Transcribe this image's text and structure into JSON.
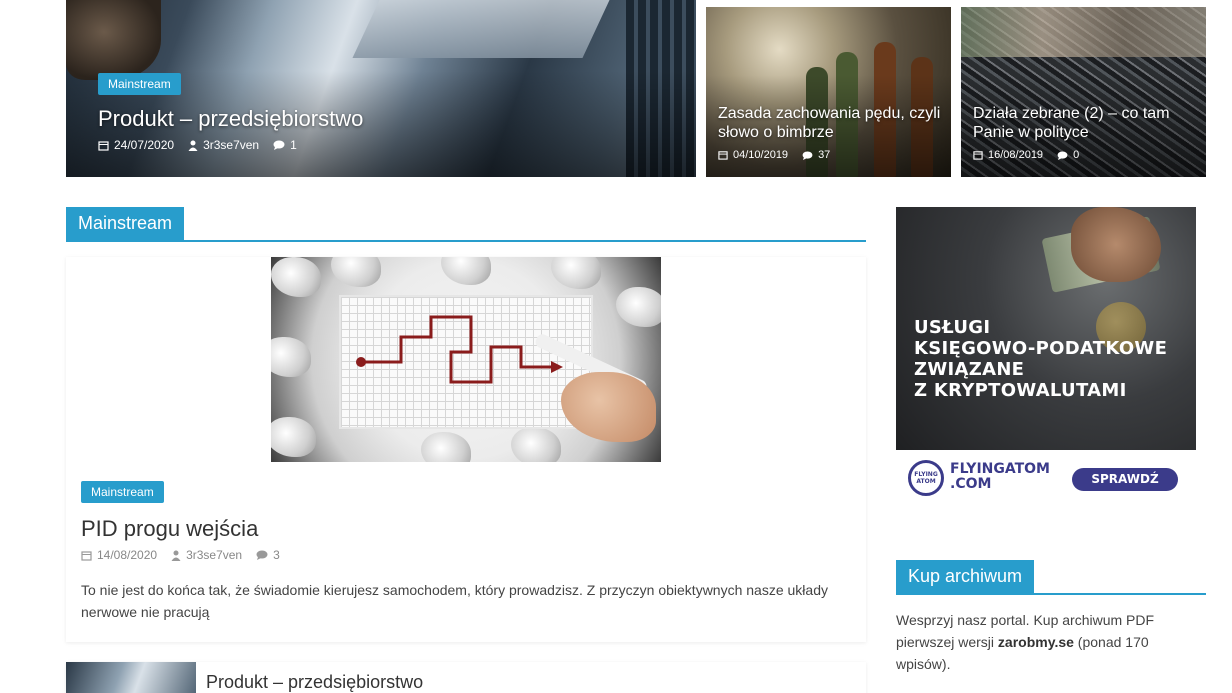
{
  "featured": {
    "big": {
      "category": "Mainstream",
      "title": "Produkt – przedsiębiorstwo",
      "date": "24/07/2020",
      "author": "3r3se7ven",
      "comments": "1"
    },
    "small": [
      {
        "title": "Zasada zachowania pędu, czyli słowo o bimbrze",
        "date": "04/10/2019",
        "comments": "37"
      },
      {
        "title": "Działa zebrane (2) – co tam Panie w polityce",
        "date": "16/08/2019",
        "comments": "0"
      }
    ]
  },
  "section": {
    "title": "Mainstream"
  },
  "post": {
    "category": "Mainstream",
    "title": "PID progu wejścia",
    "date": "14/08/2020",
    "author": "3r3se7ven",
    "comments": "3",
    "excerpt": "To nie jest do końca tak, że świadomie kierujesz samochodem, który prowadzisz. Z przyczyn obiektywnych nasze układy nerwowe nie pracują"
  },
  "post2": {
    "title": "Produkt – przedsiębiorstwo"
  },
  "ad": {
    "lines": [
      "USŁUGI",
      "KSIĘGOWO-PODATKOWE",
      "ZWIĄZANE",
      "Z KRYPTOWALUTAMI"
    ],
    "logo_top": "FLYING",
    "logo_bottom": "ATOM",
    "brand_line1": "FLYINGATOM",
    "brand_line2": ".COM",
    "button": "SPRAWDŹ"
  },
  "widget": {
    "title": "Kup archiwum",
    "text_before": "Wesprzyj nasz portal. Kup archiwum PDF pierwszej wersji ",
    "text_bold": "zarobmy.se",
    "text_after": " (ponad 170 wpisów)."
  },
  "colors": {
    "accent": "#289dcc",
    "ad_brand": "#3b3b8a"
  },
  "icons": [
    "calendar-icon",
    "user-icon",
    "comment-icon"
  ]
}
